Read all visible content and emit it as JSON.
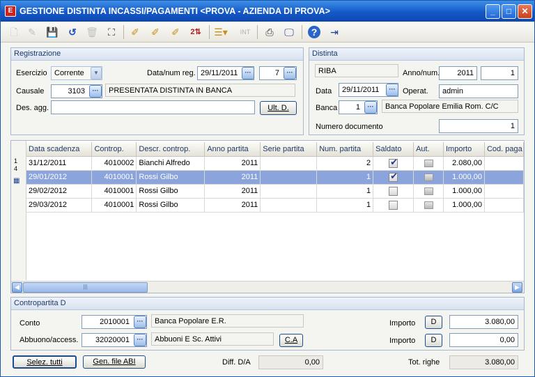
{
  "window": {
    "title": "GESTIONE DISTINTA INCASSI/PAGAMENTI <PROVA - AZIENDA DI PROVA>",
    "app_icon_glyph": "E"
  },
  "toolbar": {
    "icons": [
      "new-doc-icon",
      "open-icon",
      "save-icon",
      "undo-icon",
      "delete-icon",
      "binoculars-icon",
      "pencil-1-icon",
      "pencil-2-icon",
      "pencil-3-icon",
      "2-icon",
      "list-icon",
      "int-icon",
      "print-icon",
      "monitor-icon",
      "help-icon",
      "exit-icon"
    ],
    "int_label": "INT"
  },
  "registrazione": {
    "title": "Registrazione",
    "esercizio_label": "Esercizio",
    "esercizio_value": "Corrente",
    "data_num_reg_label": "Data/num reg.",
    "data_reg_value": "29/11/2011",
    "num_reg_value": "7",
    "causale_label": "Causale",
    "causale_code": "3103",
    "causale_desc": "PRESENTATA DISTINTA IN BANCA",
    "des_agg_label": "Des. agg.",
    "des_agg_value": "",
    "ult_d_button": "Ult. D."
  },
  "distinta": {
    "title": "Distinta",
    "tipo_value": "RIBA",
    "anno_num_label": "Anno/num.",
    "anno_value": "2011",
    "num_value": "1",
    "data_label": "Data",
    "data_value": "29/11/2011",
    "operat_label": "Operat.",
    "operat_value": "admin",
    "banca_label": "Banca",
    "banca_code": "1",
    "banca_desc": "Banca Popolare Emilia Rom. C/C",
    "numero_documento_label": "Numero documento",
    "numero_documento_value": "1"
  },
  "grid": {
    "gutter_top": "1",
    "gutter_second": "4",
    "columns": [
      "Data scadenza",
      "Controp.",
      "Descr. controp.",
      "Anno partita",
      "Serie partita",
      "Num. partita",
      "Saldato",
      "Aut.",
      "Importo",
      "Cod. paga"
    ],
    "rows": [
      {
        "data": "31/12/2011",
        "controp": "4010002",
        "descr": "Bianchi Alfredo",
        "anno": "2011",
        "serie": "",
        "num": "2",
        "saldato": true,
        "importo": "2.080,00",
        "cod": "",
        "selected": false
      },
      {
        "data": "29/01/2012",
        "controp": "4010001",
        "descr": "Rossi Gilbo",
        "anno": "2011",
        "serie": "",
        "num": "1",
        "saldato": true,
        "importo": "1.000,00",
        "cod": "",
        "selected": true
      },
      {
        "data": "29/02/2012",
        "controp": "4010001",
        "descr": "Rossi Gilbo",
        "anno": "2011",
        "serie": "",
        "num": "1",
        "saldato": false,
        "importo": "1.000,00",
        "cod": "",
        "selected": false
      },
      {
        "data": "29/03/2012",
        "controp": "4010001",
        "descr": "Rossi Gilbo",
        "anno": "2011",
        "serie": "",
        "num": "1",
        "saldato": false,
        "importo": "1.000,00",
        "cod": "",
        "selected": false
      }
    ]
  },
  "contropartita": {
    "title": "Contropartita D",
    "conto_label": "Conto",
    "conto_code": "2010001",
    "conto_desc": "Banca Popolare E.R.",
    "abbuono_label": "Abbuono/access.",
    "abbuono_code": "32020001",
    "abbuono_desc": "Abbuoni E Sc. Attivi",
    "ca_button": "C.A",
    "importo_label_1": "Importo",
    "importo_dc_1": "D",
    "importo_value_1": "3.080,00",
    "importo_label_2": "Importo",
    "importo_dc_2": "D",
    "importo_value_2": "0,00"
  },
  "footer": {
    "selez_tutti": "Selez. tutti",
    "gen_file_abi": "Gen. file ABI",
    "diff_label": "Diff. D/A",
    "diff_value": "0,00",
    "tot_righe_label": "Tot. righe",
    "tot_righe_value": "3.080,00"
  },
  "colors": {
    "titlebar": "#1559c8",
    "selected_row": "#8ca4dc",
    "panel_header": "#1f3a64"
  }
}
